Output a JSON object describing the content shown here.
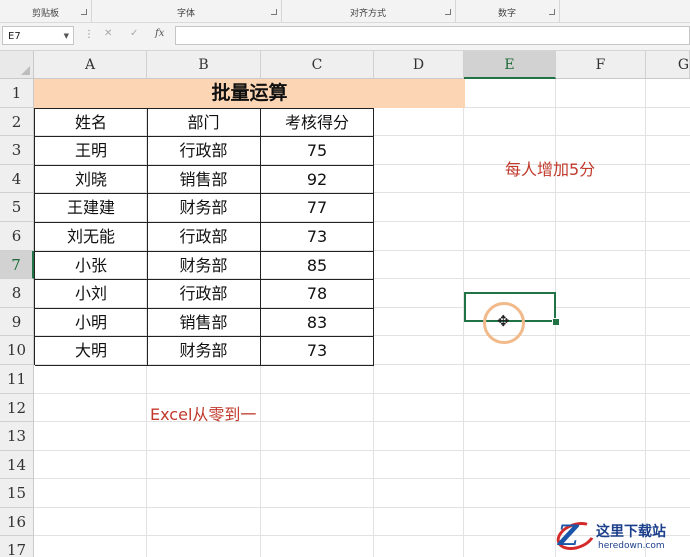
{
  "ribbon": {
    "groups": [
      "剪贴板",
      "字体",
      "对齐方式",
      "数字"
    ]
  },
  "formula_bar": {
    "name_box": "E7",
    "fx_label": "fx",
    "cancel_glyph": "✕",
    "enter_glyph": "✓",
    "formula": ""
  },
  "sheet": {
    "columns": [
      "A",
      "B",
      "C",
      "D",
      "E",
      "F",
      "G"
    ],
    "rows": [
      "1",
      "2",
      "3",
      "4",
      "5",
      "6",
      "7",
      "8",
      "9",
      "10",
      "11",
      "12",
      "13",
      "14",
      "15",
      "16",
      "17"
    ],
    "selected_cell": "E7",
    "title": "批量运算",
    "headers": [
      "姓名",
      "部门",
      "考核得分"
    ],
    "records": [
      [
        "王明",
        "行政部",
        "75"
      ],
      [
        "刘晓",
        "销售部",
        "92"
      ],
      [
        "王建建",
        "财务部",
        "77"
      ],
      [
        "刘无能",
        "行政部",
        "73"
      ],
      [
        "小张",
        "财务部",
        "85"
      ],
      [
        "小刘",
        "行政部",
        "78"
      ],
      [
        "小明",
        "销售部",
        "83"
      ],
      [
        "大明",
        "财务部",
        "73"
      ]
    ],
    "note_e4": "每人增加5分",
    "note_b12": "Excel从零到一"
  },
  "watermark": {
    "letter": "Z",
    "title": "这里下载站",
    "url": "heredown.com"
  },
  "colors": {
    "title_fill": "#fcd5b4",
    "note_text": "#c0392b",
    "selection": "#217346"
  }
}
